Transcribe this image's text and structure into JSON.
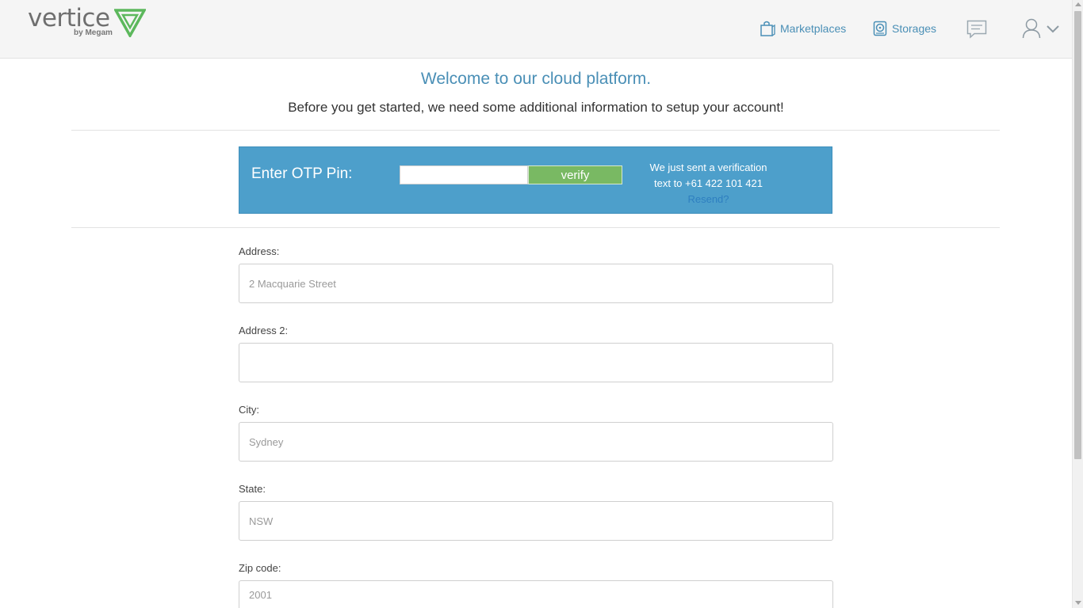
{
  "header": {
    "logo_word": "vertice",
    "logo_sub": "by Megam",
    "nav_marketplaces": "Marketplaces",
    "nav_storages": "Storages"
  },
  "welcome": {
    "title": "Welcome to our cloud platform.",
    "subtitle": "Before you get started, we need some additional information to setup your account!"
  },
  "otp": {
    "label": "Enter OTP Pin:",
    "input_value": "",
    "verify_label": "verify",
    "message_line1": "We just sent a verification",
    "message_line2": "text to +61 422 101 421",
    "resend_label": "Resend?"
  },
  "form": {
    "address_label": "Address:",
    "address_placeholder": "2 Macquarie Street",
    "address2_label": "Address 2:",
    "address2_placeholder": "",
    "city_label": "City:",
    "city_placeholder": "Sydney",
    "state_label": "State:",
    "state_placeholder": "NSW",
    "zip_label": "Zip code:",
    "zip_placeholder": "2001"
  },
  "colors": {
    "accent": "#4a8fb6",
    "otp_bg": "#4d9fcb",
    "verify_bg": "#79b963",
    "logo_green": "#5cb85c"
  }
}
